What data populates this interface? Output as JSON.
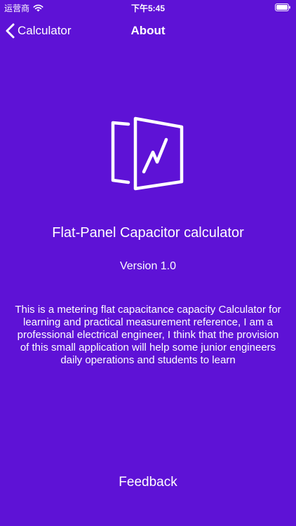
{
  "status_bar": {
    "carrier": "运营商",
    "time": "下午5:45"
  },
  "nav": {
    "back_label": "Calculator",
    "title": "About"
  },
  "app": {
    "name": "Flat-Panel Capacitor calculator",
    "version": "Version 1.0",
    "description": "This is a metering flat capacitance capacity Calculator for learning and practical measurement reference, I am a professional electrical engineer, I think that the provision of this small application will help some junior engineers daily operations and students to learn"
  },
  "feedback_label": "Feedback",
  "colors": {
    "background": "#5e12d6",
    "foreground": "#ffffff"
  },
  "icons": {
    "signal": "wifi-icon",
    "battery": "battery-icon",
    "back": "chevron-left-icon",
    "app": "flat-panel-capacitor-icon"
  }
}
